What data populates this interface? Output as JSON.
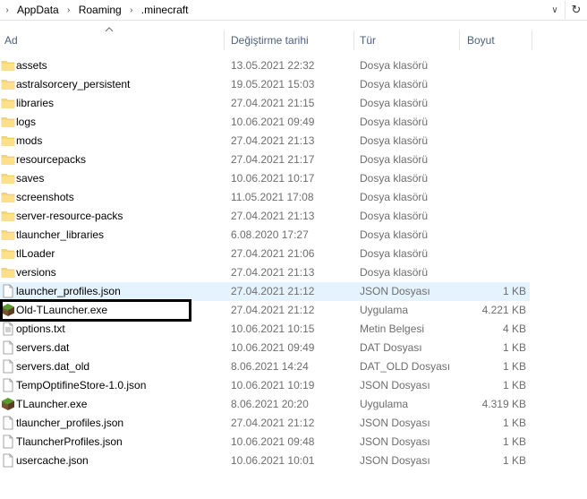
{
  "breadcrumb": {
    "items": [
      "AppData",
      "Roaming",
      ".minecraft"
    ]
  },
  "columns": {
    "name": "Ad",
    "date": "Değiştirme tarihi",
    "type": "Tür",
    "size": "Boyut"
  },
  "rows": [
    {
      "name": "assets",
      "date": "13.05.2021 22:32",
      "type": "Dosya klasörü",
      "size": "",
      "icon": "folder-icon"
    },
    {
      "name": "astralsorcery_persistent",
      "date": "19.05.2021 15:03",
      "type": "Dosya klasörü",
      "size": "",
      "icon": "folder-icon"
    },
    {
      "name": "libraries",
      "date": "27.04.2021 21:15",
      "type": "Dosya klasörü",
      "size": "",
      "icon": "folder-icon"
    },
    {
      "name": "logs",
      "date": "10.06.2021 09:49",
      "type": "Dosya klasörü",
      "size": "",
      "icon": "folder-icon"
    },
    {
      "name": "mods",
      "date": "27.04.2021 21:13",
      "type": "Dosya klasörü",
      "size": "",
      "icon": "folder-icon"
    },
    {
      "name": "resourcepacks",
      "date": "27.04.2021 21:17",
      "type": "Dosya klasörü",
      "size": "",
      "icon": "folder-icon"
    },
    {
      "name": "saves",
      "date": "10.06.2021 10:17",
      "type": "Dosya klasörü",
      "size": "",
      "icon": "folder-icon"
    },
    {
      "name": "screenshots",
      "date": "11.05.2021 17:08",
      "type": "Dosya klasörü",
      "size": "",
      "icon": "folder-icon"
    },
    {
      "name": "server-resource-packs",
      "date": "27.04.2021 21:13",
      "type": "Dosya klasörü",
      "size": "",
      "icon": "folder-icon"
    },
    {
      "name": "tlauncher_libraries",
      "date": "6.08.2020 17:27",
      "type": "Dosya klasörü",
      "size": "",
      "icon": "folder-icon"
    },
    {
      "name": "tlLoader",
      "date": "27.04.2021 21:06",
      "type": "Dosya klasörü",
      "size": "",
      "icon": "folder-icon"
    },
    {
      "name": "versions",
      "date": "27.04.2021 21:13",
      "type": "Dosya klasörü",
      "size": "",
      "icon": "folder-icon"
    },
    {
      "name": "launcher_profiles.json",
      "date": "27.04.2021 21:12",
      "type": "JSON Dosyası",
      "size": "1 KB",
      "icon": "file-icon"
    },
    {
      "name": "Old-TLauncher.exe",
      "date": "27.04.2021 21:12",
      "type": "Uygulama",
      "size": "4.221 KB",
      "icon": "minecraft-block-icon"
    },
    {
      "name": "options.txt",
      "date": "10.06.2021 10:15",
      "type": "Metin Belgesi",
      "size": "4 KB",
      "icon": "text-file-icon"
    },
    {
      "name": "servers.dat",
      "date": "10.06.2021 09:49",
      "type": "DAT Dosyası",
      "size": "1 KB",
      "icon": "file-icon"
    },
    {
      "name": "servers.dat_old",
      "date": "8.06.2021 14:24",
      "type": "DAT_OLD Dosyası",
      "size": "1 KB",
      "icon": "file-icon"
    },
    {
      "name": "TempOptifineStore-1.0.json",
      "date": "10.06.2021 10:19",
      "type": "JSON Dosyası",
      "size": "1 KB",
      "icon": "file-icon"
    },
    {
      "name": "TLauncher.exe",
      "date": "8.06.2021 20:20",
      "type": "Uygulama",
      "size": "4.319 KB",
      "icon": "minecraft-block-icon"
    },
    {
      "name": "tlauncher_profiles.json",
      "date": "27.04.2021 21:12",
      "type": "JSON Dosyası",
      "size": "1 KB",
      "icon": "file-icon"
    },
    {
      "name": "TlauncherProfiles.json",
      "date": "10.06.2021 09:48",
      "type": "JSON Dosyası",
      "size": "1 KB",
      "icon": "file-icon"
    },
    {
      "name": "usercache.json",
      "date": "10.06.2021 10:01",
      "type": "JSON Dosyası",
      "size": "1 KB",
      "icon": "file-icon"
    }
  ],
  "colors": {
    "folder": "#f8d775",
    "hover_row": "#e5f3ff",
    "header_text": "#4c607a",
    "annotation_box": "#000000"
  }
}
